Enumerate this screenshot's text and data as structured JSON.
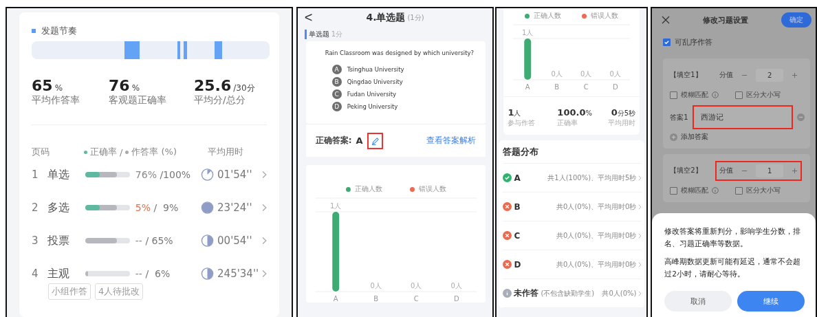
{
  "stats_panel": {
    "rhythm_title": "发题节奏",
    "summary": [
      {
        "value": "65",
        "unit": "%",
        "label": "平均作答率"
      },
      {
        "value": "76",
        "unit": "%",
        "label": "客观题正确率"
      },
      {
        "value": "25.6",
        "unit": "/30分",
        "label": "平均分/总分"
      }
    ],
    "header": {
      "page": "页码",
      "correct_legend": "正确率",
      "separator": "/",
      "answered_legend": "作答率 (%)",
      "time": "平均用时"
    },
    "rows": [
      {
        "number": "1",
        "type": "单选",
        "correct_bar": {
          "level": 0.32
        },
        "answered_bar": {
          "level": 0.71
        },
        "correct": "76%",
        "low": false,
        "answered": "/100%",
        "time_icon": {
          "kind": "slice"
        },
        "time": "01'54''"
      },
      {
        "number": "2",
        "type": "多选",
        "correct_bar": {
          "level": 0.32
        },
        "answered_bar": {
          "level": 0.71
        },
        "correct": "5%",
        "low": true,
        "answered": "/  9%",
        "time_icon": {
          "kind": "full"
        },
        "time": "23'24''"
      },
      {
        "number": "3",
        "type": "投票",
        "answered_bar": {
          "level": 0.71
        },
        "correct": "--",
        "low": false,
        "answered": "/ 65%",
        "time_icon": {
          "kind": "half"
        },
        "time": "00'54''"
      },
      {
        "number": "4",
        "type": "主观",
        "answered_bar": {
          "level": 0.06
        },
        "correct": "--",
        "low": false,
        "answered": "/  6%",
        "time_icon": {
          "kind": "half"
        },
        "time": "245'34''",
        "tags": [
          "小组作答",
          "4人待批改"
        ]
      }
    ]
  },
  "question_panel": {
    "back": "<",
    "title": "4.单选题",
    "points": "(1分)",
    "tag": "单选题",
    "tag_points": "1分",
    "question": "Rain Classroom was designed by which university?",
    "options": [
      {
        "letter": "A",
        "text": "Tsinghua University"
      },
      {
        "letter": "B",
        "text": "Qingdao University"
      },
      {
        "letter": "C",
        "text": "Fudan University"
      },
      {
        "letter": "D",
        "text": "Peking University"
      }
    ],
    "answer_label": "正确答案:",
    "answer": "A",
    "edit_highlighted": true,
    "analysis_link": "查看答案解析",
    "chart_data": {
      "type": "bar",
      "categories": [
        "A",
        "B",
        "C",
        "D"
      ],
      "series": [
        {
          "name": "正确人数",
          "color": "#3dab73",
          "values": [
            1,
            0,
            0,
            0
          ]
        },
        {
          "name": "错误人数",
          "color": "#ee6a55",
          "values": [
            null,
            null,
            null,
            null
          ]
        }
      ],
      "data_labels": true
    },
    "count_units": [
      "人",
      "人",
      "人",
      "人"
    ]
  },
  "result_panel": {
    "chart_data": {
      "type": "bar",
      "categories": [
        "A",
        "B",
        "C",
        "D"
      ],
      "series": [
        {
          "name": "正确人数",
          "color": "#3dab73",
          "values": [
            1,
            0,
            0,
            0
          ]
        },
        {
          "name": "错误人数",
          "color": "#ee6a55",
          "values": [
            null,
            null,
            null,
            null
          ]
        }
      ],
      "data_labels": true
    },
    "count_units": [
      "人",
      "人",
      "人",
      "人"
    ],
    "stats": [
      {
        "value": "1",
        "unit": "人",
        "label": "参与作答"
      },
      {
        "value": "100.0",
        "unit": "%",
        "label": "正确率"
      },
      {
        "value": "0",
        "unit": "分5秒",
        "label": "平均用时"
      }
    ],
    "distribution_title": "答题分布",
    "distribution": [
      {
        "kind": "correct",
        "option": "A",
        "summary": "共1人(100%)、平均用时5秒"
      },
      {
        "kind": "wrong",
        "option": "B",
        "summary": "共0人(0%)、平均用时0秒"
      },
      {
        "kind": "wrong",
        "option": "C",
        "summary": "共0人(0%)、平均用时0秒"
      },
      {
        "kind": "wrong",
        "option": "D",
        "summary": "共0人(0%)、平均用时0秒"
      },
      {
        "kind": "unanswered",
        "option": "未作答",
        "note": "(不包含缺勤学生)",
        "summary": "共0人(0%)"
      }
    ]
  },
  "settings_panel": {
    "title": "修改习题设置",
    "confirm": "确定",
    "shuffle": {
      "label": "可乱序作答",
      "checked": true
    },
    "blanks": [
      {
        "name": "【填空1】",
        "score_label": "分值",
        "score": "2",
        "score_highlighted": false,
        "fuzzy": {
          "label": "模糊匹配",
          "checked": false
        },
        "case": {
          "label": "区分大小写",
          "checked": false
        },
        "answers": [
          {
            "label": "答案1",
            "value": "西游记",
            "highlighted": true
          }
        ],
        "add_answer": "添加答案"
      },
      {
        "name": "【填空2】",
        "score_label": "分值",
        "score": "1",
        "score_highlighted": true,
        "fuzzy": {
          "label": "模糊匹配",
          "checked": false
        },
        "case": {
          "label": "区分大小写",
          "checked": false
        }
      }
    ],
    "sheet": {
      "paragraphs": [
        "修改答案将重新判分，影响学生分数，排名、习题正确率等数据。",
        "高峰期数据更新可能有延迟，通常不会超过2小时，请耐心等待。"
      ],
      "cancel": "取消",
      "continue": "继续"
    }
  }
}
